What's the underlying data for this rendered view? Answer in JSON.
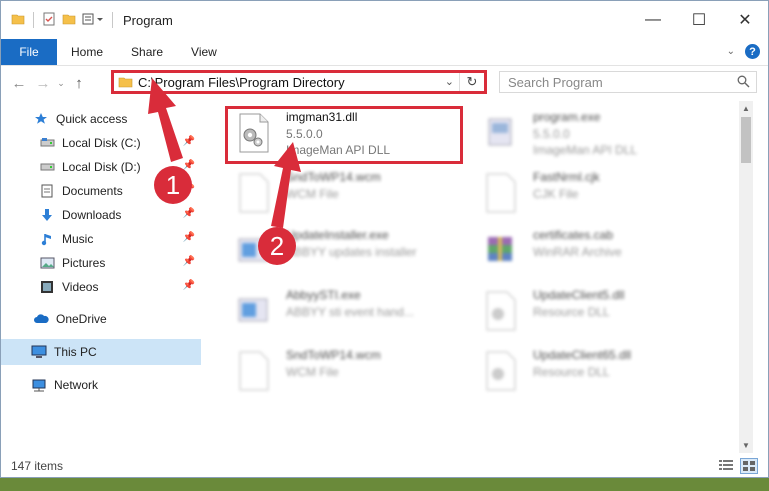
{
  "window": {
    "title": "Program"
  },
  "ribbon": {
    "tabs": [
      "File",
      "Home",
      "Share",
      "View"
    ],
    "help": "?"
  },
  "address": {
    "path": "C:\\Program Files\\Program Directory"
  },
  "search": {
    "placeholder": "Search Program"
  },
  "sidebar": {
    "items": [
      {
        "label": "Quick access",
        "icon": "star-icon"
      },
      {
        "label": "Local Disk (C:)",
        "icon": "drive-icon"
      },
      {
        "label": "Local Disk (D:)",
        "icon": "drive-icon"
      },
      {
        "label": "Documents",
        "icon": "documents-icon"
      },
      {
        "label": "Downloads",
        "icon": "downloads-icon"
      },
      {
        "label": "Music",
        "icon": "music-icon"
      },
      {
        "label": "Pictures",
        "icon": "pictures-icon"
      },
      {
        "label": "Videos",
        "icon": "videos-icon"
      },
      {
        "label": "OneDrive",
        "icon": "cloud-icon"
      },
      {
        "label": "This PC",
        "icon": "computer-icon"
      },
      {
        "label": "Network",
        "icon": "network-icon"
      }
    ]
  },
  "files": [
    {
      "name": "imgman31.dll",
      "line2": "5.5.0.0",
      "line3": "ImageMan API DLL"
    },
    {
      "name": "program.exe",
      "line2": "5.5.0.0",
      "line3": "ImageMan API DLL"
    },
    {
      "name": "SndToWP14.wcm",
      "line2": "WCM File",
      "line3": ""
    },
    {
      "name": "FastNrml.cjk",
      "line2": "CJK File",
      "line3": ""
    },
    {
      "name": "UpdateInstaller.exe",
      "line2": "ABBYY updates installer",
      "line3": ""
    },
    {
      "name": "certificates.cab",
      "line2": "WinRAR Archive",
      "line3": ""
    },
    {
      "name": "AbbyySTI.exe",
      "line2": "ABBYY sti event hand...",
      "line3": ""
    },
    {
      "name": "UpdateClient5.dll",
      "line2": "Resource DLL",
      "line3": ""
    },
    {
      "name": "SndToWP14.wcm",
      "line2": "WCM File",
      "line3": ""
    },
    {
      "name": "UpdateClient65.dll",
      "line2": "Resource DLL",
      "line3": ""
    }
  ],
  "annotations": {
    "step1": "1",
    "step2": "2"
  },
  "status": {
    "items": "147 items"
  },
  "colors": {
    "accent": "#1a6cc4",
    "highlight": "#d92c3a"
  }
}
